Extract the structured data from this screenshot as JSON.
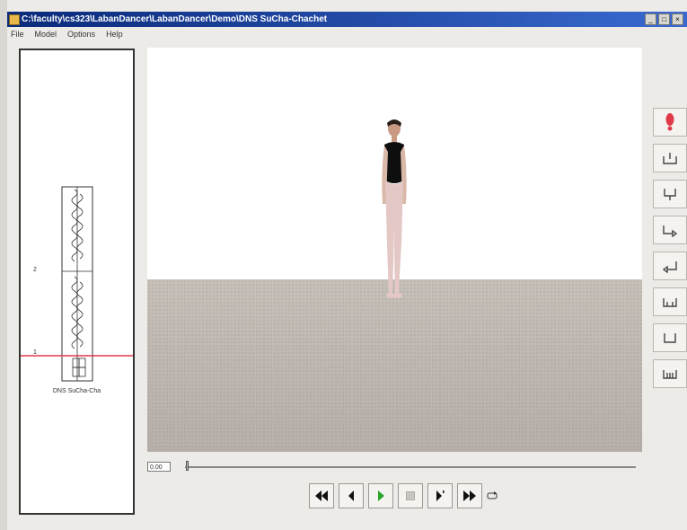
{
  "window": {
    "title": "C:\\faculty\\cs323\\LabanDancer\\LabanDancer\\Demo\\DNS SuCha-Chachet",
    "buttons": [
      "_",
      "□",
      "×"
    ]
  },
  "menu": {
    "items": [
      "File",
      "Model",
      "Options",
      "Help"
    ]
  },
  "score_panel": {
    "caption": "DNS SuCha-Cha",
    "marker_labels": [
      "2",
      "1"
    ]
  },
  "timeline": {
    "time_value": "0.00",
    "position": 0.0
  },
  "transport": {
    "buttons": [
      "rewind-to-start",
      "step-back",
      "play",
      "stop",
      "step-forward",
      "fast-forward-to-end",
      "loop"
    ]
  },
  "side_tools": {
    "buttons": [
      "foot-marker",
      "tool-1",
      "tool-2",
      "tool-3",
      "tool-4",
      "tool-5",
      "tool-6",
      "tool-7"
    ]
  },
  "colors": {
    "title_bar": "#0a2a7a",
    "play_green": "#2aa52a",
    "marker_red": "#e03a4a",
    "score_playhead": "#e03a4a"
  }
}
